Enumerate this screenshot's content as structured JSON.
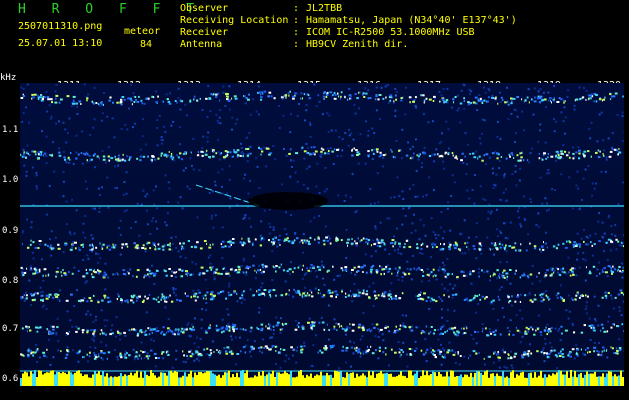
{
  "header": {
    "title": "H R O F F T",
    "filename": "2507011310.png",
    "meteor_label": "meteor",
    "datetime": "25.07.01 13:10",
    "count": "84"
  },
  "info": [
    {
      "key": "Observer",
      "value": "JL2TBB"
    },
    {
      "key": "Receiving Location",
      "value": "Hamamatsu, Japan (N34°40' E137°43')"
    },
    {
      "key": "Receiver",
      "value": "ICOM IC-R2500 53.1000MHz USB"
    },
    {
      "key": "Antenna",
      "value": "HB9CV Zenith dir."
    }
  ],
  "axis": {
    "y_unit": "kHz",
    "y_ticks": [
      "1.1",
      "1.0",
      "0.9",
      "0.8",
      "0.7",
      "0.6"
    ],
    "x_ticks": [
      "1311",
      "1312",
      "1313",
      "1314",
      "1315",
      "1316",
      "1317",
      "1318",
      "1319",
      "1320"
    ]
  },
  "colors": {
    "background": "#000000",
    "header_green": "#2bd02b",
    "header_yellow": "#ffff00",
    "trace": "#3be0ff",
    "spectrum_high": "#ffff00"
  }
}
